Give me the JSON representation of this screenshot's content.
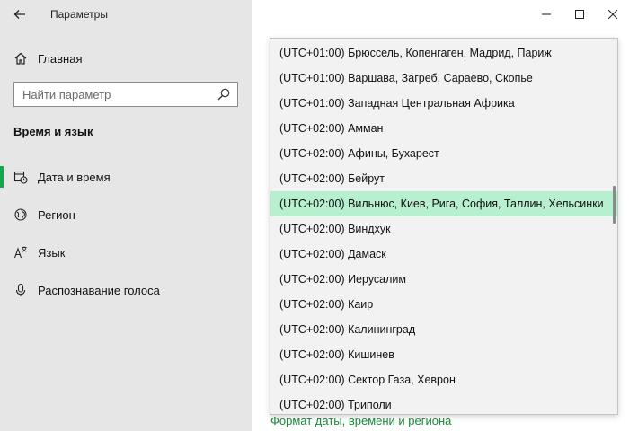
{
  "app": {
    "title": "Параметры"
  },
  "sidebar": {
    "home_label": "Главная",
    "search_placeholder": "Найти параметр",
    "section_title": "Время и язык",
    "items": [
      {
        "label": "Дата и время",
        "icon": "calendar-clock-icon",
        "active": true
      },
      {
        "label": "Регион",
        "icon": "globe-icon",
        "active": false
      },
      {
        "label": "Язык",
        "icon": "language-icon",
        "active": false
      },
      {
        "label": "Распознавание голоса",
        "icon": "microphone-icon",
        "active": false
      }
    ]
  },
  "main": {
    "footer_link": "Формат даты, времени и региона"
  },
  "timezones": {
    "selected_index": 6,
    "items": [
      "(UTC+01:00) Брюссель, Копенгаген, Мадрид, Париж",
      "(UTC+01:00) Варшава, Загреб, Сараево, Скопье",
      "(UTC+01:00) Западная Центральная Африка",
      "(UTC+02:00) Амман",
      "(UTC+02:00) Афины, Бухарест",
      "(UTC+02:00) Бейрут",
      "(UTC+02:00) Вильнюс, Киев, Рига, София, Таллин, Хельсинки",
      "(UTC+02:00) Виндхук",
      "(UTC+02:00) Дамаск",
      "(UTC+02:00) Иерусалим",
      "(UTC+02:00) Каир",
      "(UTC+02:00) Калининград",
      "(UTC+02:00) Кишинев",
      "(UTC+02:00) Сектор Газа, Хеврон",
      "(UTC+02:00) Триполи"
    ]
  },
  "colors": {
    "accent": "#11a84a",
    "selected_bg": "#b7f0cf",
    "sidebar_bg": "#e6e6e6"
  }
}
